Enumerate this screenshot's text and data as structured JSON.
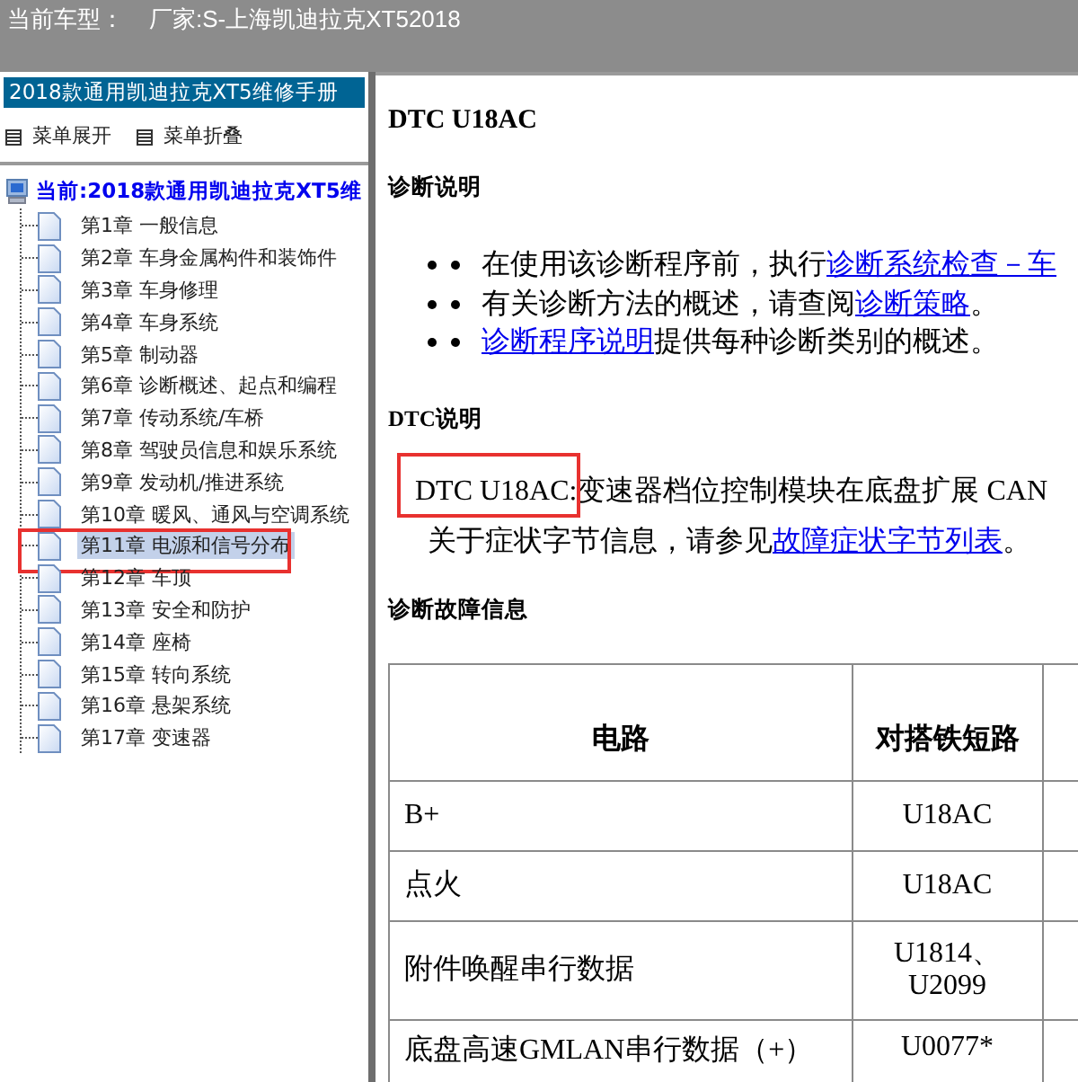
{
  "top_bar": {
    "label": "当前车型：",
    "maker": "厂家:S-上海凯迪拉克XT52018"
  },
  "sidebar": {
    "title": "2018款通用凯迪拉克XT5维修手册",
    "menu_buttons": [
      {
        "label": "菜单展开"
      },
      {
        "label": "菜单折叠"
      }
    ],
    "tree": {
      "label": "当前:2018款通用凯迪拉克XT5维",
      "children": [
        {
          "label": "第1章 一般信息",
          "selected": false,
          "annotated": false
        },
        {
          "label": "第2章 车身金属构件和装饰件",
          "selected": false,
          "annotated": false
        },
        {
          "label": "第3章 车身修理",
          "selected": false,
          "annotated": false
        },
        {
          "label": "第4章 车身系统",
          "selected": false,
          "annotated": false
        },
        {
          "label": "第5章 制动器",
          "selected": false,
          "annotated": false
        },
        {
          "label": "第6章 诊断概述、起点和编程",
          "selected": false,
          "annotated": false
        },
        {
          "label": "第7章 传动系统/车桥",
          "selected": false,
          "annotated": false
        },
        {
          "label": "第8章 驾驶员信息和娱乐系统",
          "selected": false,
          "annotated": false
        },
        {
          "label": "第9章 发动机/推进系统",
          "selected": false,
          "annotated": false
        },
        {
          "label": "第10章 暖风、通风与空调系统",
          "selected": false,
          "annotated": false
        },
        {
          "label": "第11章 电源和信号分布",
          "selected": true,
          "annotated": true
        },
        {
          "label": "第12章 车顶",
          "selected": false,
          "annotated": false
        },
        {
          "label": "第13章 安全和防护",
          "selected": false,
          "annotated": false
        },
        {
          "label": "第14章 座椅",
          "selected": false,
          "annotated": false
        },
        {
          "label": "第15章 转向系统",
          "selected": false,
          "annotated": false
        },
        {
          "label": "第16章 悬架系统",
          "selected": false,
          "annotated": false
        },
        {
          "label": "第17章 变速器",
          "selected": false,
          "annotated": false
        }
      ]
    }
  },
  "content": {
    "title": "DTC U18AC",
    "diag_heading": "诊断说明",
    "bullets": [
      {
        "parts": [
          {
            "text": "在使用该诊断程序前，执行",
            "link": false
          },
          {
            "text": "诊断系统检查－车",
            "link": true
          }
        ]
      },
      {
        "parts": [
          {
            "text": "有关诊断方法的概述，请查阅",
            "link": false
          },
          {
            "text": "诊断策略",
            "link": true
          },
          {
            "text": "。",
            "link": false
          }
        ]
      },
      {
        "parts": [
          {
            "text": "诊断程序说明",
            "link": true
          },
          {
            "text": "提供每种诊断类别的概述。",
            "link": false
          }
        ]
      }
    ],
    "dtc_heading": "DTC说明",
    "dtc_code": {
      "text": "DTC U18AC:",
      "annotated": true
    },
    "dtc_text": "变速器档位控制模块在底盘扩展 CAN",
    "dtc_line2": [
      {
        "text": "关于症状字节信息，请参见",
        "link": false
      },
      {
        "text": "故障症状字节列表",
        "link": true
      },
      {
        "text": "。",
        "link": false
      }
    ],
    "info_heading": "诊断故障信息",
    "table": {
      "columns": [
        "电路",
        "对搭铁短路"
      ],
      "rows": [
        {
          "circuit": "B+",
          "short_to_ground": [
            "U18AC"
          ]
        },
        {
          "circuit": "点火",
          "short_to_ground": [
            "U18AC"
          ]
        },
        {
          "circuit": "附件唤醒串行数据",
          "short_to_ground": [
            "U1814、",
            "U2099"
          ]
        },
        {
          "circuit": "底盘高速GMLAN串行数据（+）",
          "short_to_ground": [
            "U0077*"
          ]
        }
      ]
    }
  }
}
